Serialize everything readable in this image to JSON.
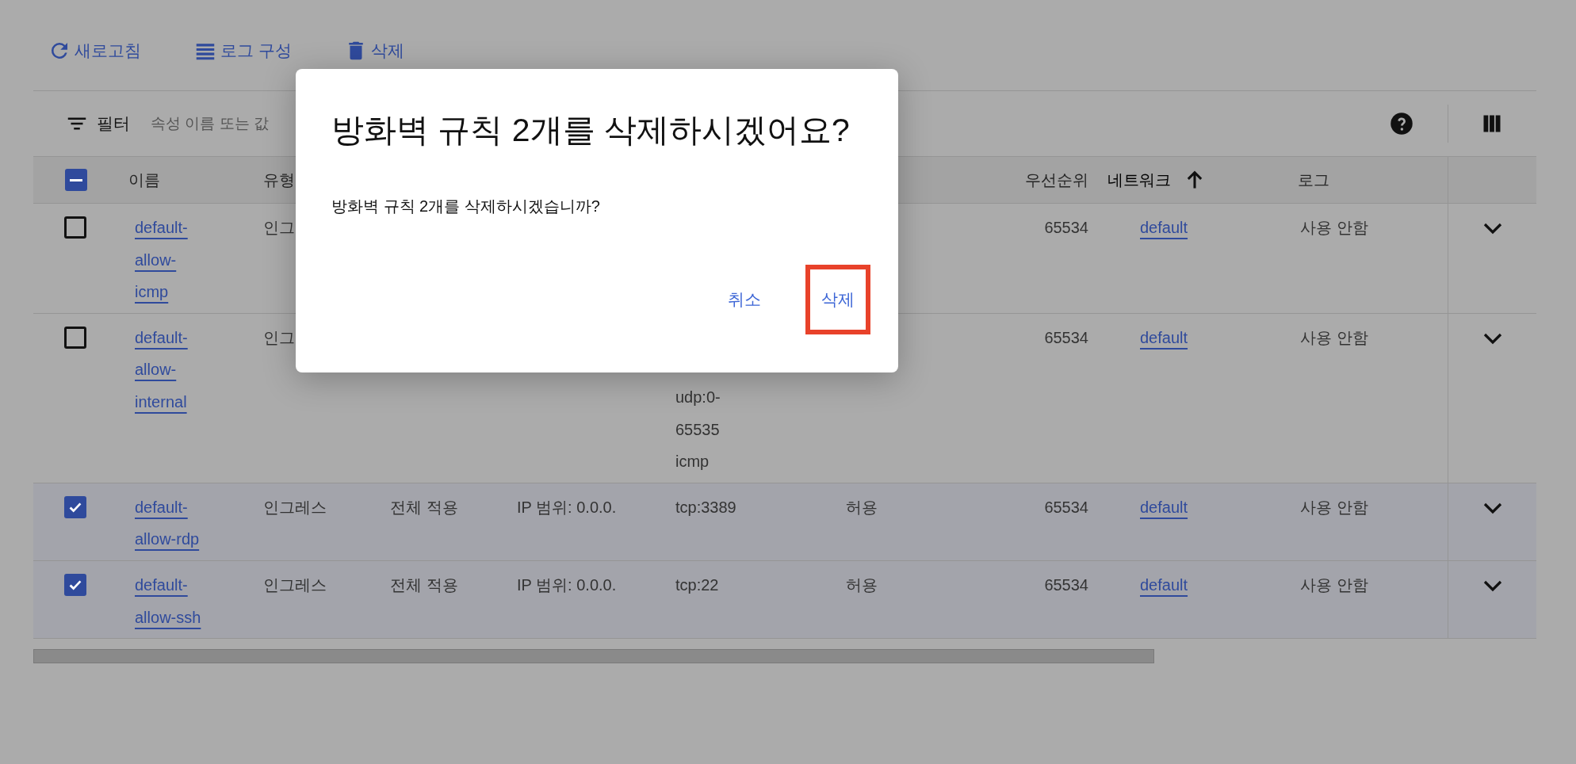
{
  "toolbar": [
    {
      "kind": "refresh",
      "label": "새로고침"
    },
    {
      "kind": "logs",
      "label": "로그 구성"
    },
    {
      "kind": "delete",
      "label": "삭제"
    }
  ],
  "filter": {
    "label": "필터",
    "placeholder": "속성 이름 또는 값"
  },
  "table": {
    "header_checkbox": {
      "indeterminate": true
    },
    "columns": [
      {
        "kind": "name",
        "label": "이름",
        "sorted": false
      },
      {
        "kind": "type",
        "label": "유형",
        "sorted": false
      },
      {
        "kind": "priority",
        "label": "우선순위",
        "sorted": false
      },
      {
        "kind": "network",
        "label": "네트워크",
        "sorted": true
      },
      {
        "kind": "log",
        "label": "로그",
        "sorted": false
      }
    ],
    "rows": [
      {
        "selected": false,
        "name": "default-allow-icmp",
        "type": "인그",
        "priority": "65534",
        "network": "default",
        "log": "사용 안함"
      },
      {
        "selected": false,
        "name": "default-allow-internal",
        "type": "인그",
        "protocols": [
          "udp:0-65535",
          "icmp"
        ],
        "priority": "65534",
        "network": "default",
        "log": "사용 안함"
      },
      {
        "selected": true,
        "name": "default-allow-rdp",
        "type": "인그레스",
        "target": "전체 적용",
        "source": "IP 범위: 0.0.0.",
        "protocols": [
          "tcp:3389"
        ],
        "action": "허용",
        "priority": "65534",
        "network": "default",
        "log": "사용 안함"
      },
      {
        "selected": true,
        "name": "default-allow-ssh",
        "type": "인그레스",
        "target": "전체 적용",
        "source": "IP 범위: 0.0.0.",
        "protocols": [
          "tcp:22"
        ],
        "action": "허용",
        "priority": "65534",
        "network": "default",
        "log": "사용 안함"
      }
    ]
  },
  "dialog": {
    "title": "방화벽 규칙 2개를 삭제하시겠어요?",
    "message": "방화벽 규칙 2개를 삭제하시겠습니까?",
    "buttons": [
      {
        "label": "취소",
        "highlighted": false
      },
      {
        "label": "삭제",
        "highlighted": true
      }
    ]
  }
}
